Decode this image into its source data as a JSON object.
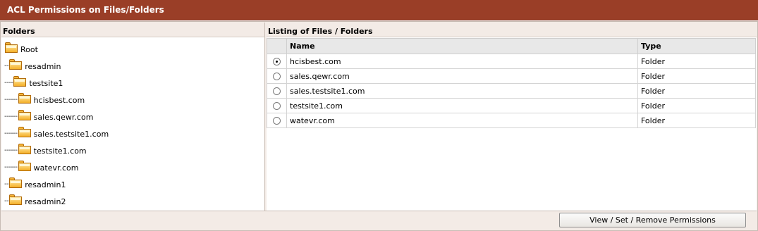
{
  "window": {
    "title": "ACL Permissions on Files/Folders"
  },
  "folders_panel": {
    "header": "Folders",
    "tree": [
      {
        "prefix": "",
        "label": "Root"
      },
      {
        "prefix": "--",
        "label": "resadmin"
      },
      {
        "prefix": "----",
        "label": "testsite1"
      },
      {
        "prefix": "------",
        "label": "hcisbest.com"
      },
      {
        "prefix": "------",
        "label": "sales.qewr.com"
      },
      {
        "prefix": "------",
        "label": "sales.testsite1.com"
      },
      {
        "prefix": "------",
        "label": "testsite1.com"
      },
      {
        "prefix": "------",
        "label": "watevr.com"
      },
      {
        "prefix": "--",
        "label": "resadmin1"
      },
      {
        "prefix": "--",
        "label": "resadmin2"
      }
    ]
  },
  "listing_panel": {
    "header": "Listing of Files / Folders",
    "columns": {
      "name": "Name",
      "type": "Type"
    },
    "rows": [
      {
        "name": "hcisbest.com",
        "type": "Folder",
        "selected": true
      },
      {
        "name": "sales.qewr.com",
        "type": "Folder",
        "selected": false
      },
      {
        "name": "sales.testsite1.com",
        "type": "Folder",
        "selected": false
      },
      {
        "name": "testsite1.com",
        "type": "Folder",
        "selected": false
      },
      {
        "name": "watevr.com",
        "type": "Folder",
        "selected": false
      }
    ]
  },
  "actions": {
    "permissions_button": "View / Set / Remove Permissions"
  },
  "colors": {
    "title_bar": "#9a3e27",
    "panel_bg": "#f3ebe6",
    "folder": "#f5b028"
  },
  "icons": {
    "tree_node": "folder-icon",
    "row_select": "radio"
  }
}
